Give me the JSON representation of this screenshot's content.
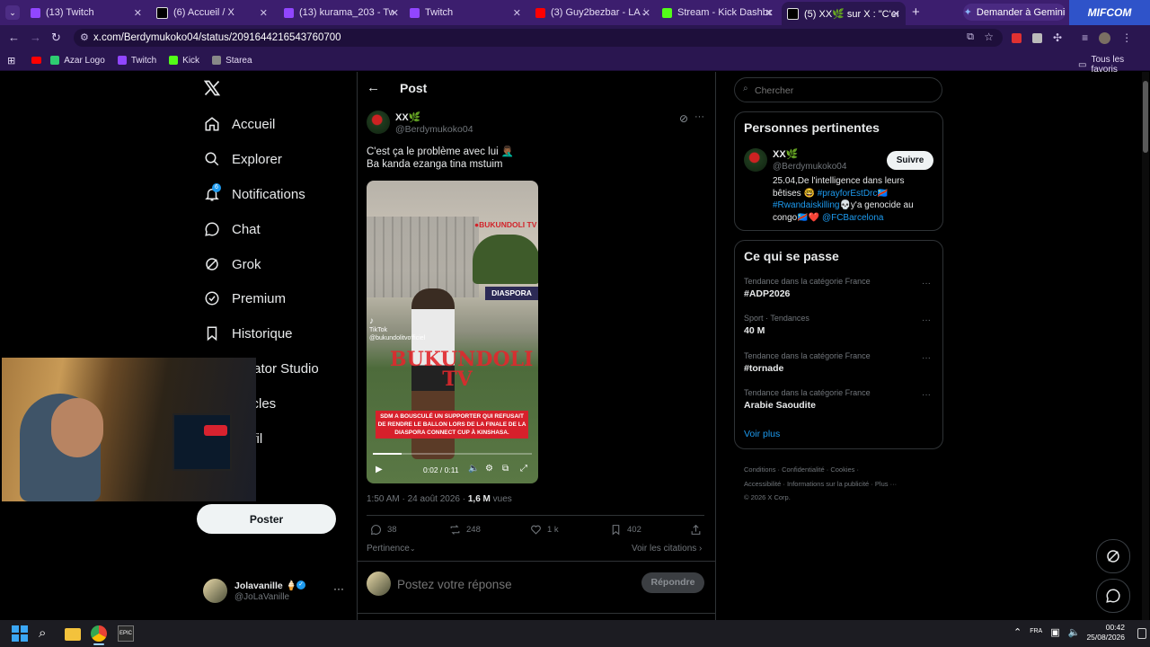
{
  "browser": {
    "tabs": [
      {
        "title": "(13) Twitch",
        "color": "#9146ff"
      },
      {
        "title": "(6) Accueil / X",
        "color": "#000000"
      },
      {
        "title": "(13) kurama_203 - Twitch",
        "color": "#9146ff"
      },
      {
        "title": "Twitch",
        "color": "#9146ff"
      },
      {
        "title": "(3) Guy2bezbar - LA JEUNE",
        "color": "#ff0000"
      },
      {
        "title": "Stream - Kick Dashboard",
        "color": "#53fc18"
      },
      {
        "title": "(5) XX🌿 sur X : \"C'est ça l",
        "color": "#000000"
      }
    ],
    "new_tab": "+",
    "gemini": "Demander à Gemini",
    "promo_badge": "MIFCOM",
    "url": "x.com/Berdymukoko04/status/2091644216543760700",
    "bookmarks": [
      {
        "label": "Azar Logo",
        "color": "#2ecc71"
      },
      {
        "label": "Twitch",
        "color": "#9146ff"
      },
      {
        "label": "Kick",
        "color": "#53fc18"
      },
      {
        "label": "Starea",
        "color": "#888888"
      }
    ],
    "all_bookmarks": "Tous les favoris"
  },
  "nav": {
    "items": [
      {
        "label": "Accueil",
        "icon": "home-icon"
      },
      {
        "label": "Explorer",
        "icon": "search-icon"
      },
      {
        "label": "Notifications",
        "icon": "bell-icon",
        "badge": "6"
      },
      {
        "label": "Chat",
        "icon": "chat-icon"
      },
      {
        "label": "Grok",
        "icon": "grok-icon"
      },
      {
        "label": "Premium",
        "icon": "premium-icon"
      },
      {
        "label": "Historique",
        "icon": "bookmark-icon"
      },
      {
        "label": "Creator Studio",
        "icon": "studio-icon"
      },
      {
        "label": "Articles",
        "icon": "article-icon"
      },
      {
        "label": "Profil",
        "icon": "profile-icon"
      }
    ],
    "post_button": "Poster",
    "account": {
      "name": "Jolavanille 🍦",
      "handle": "@JoLaVanille"
    }
  },
  "post": {
    "header": "Post",
    "author": {
      "name": "XX🌿",
      "handle": "@Berdymukoko04"
    },
    "text_line1": "C'est ça le problème avec lui 🤦🏾‍♂️",
    "text_line2": "Ba kanda ezanga tina mstuim",
    "video": {
      "logo_text": "BUKUNDOLI TV",
      "banner": "DIASPORA",
      "tiktok": "TikTok",
      "tiktok_handle": "@bukundolitvofficiel",
      "watermark": "BUKUNDOLI TV",
      "caption": "SDM A BOUSCULÉ UN SUPPORTER QUI REFUSAIT DE RENDRE LE BALLON LORS DE LA FINALE DE LA DIASPORA CONNECT CUP À KINSHASA.",
      "time": "0:02 / 0:11",
      "progress": 0.18
    },
    "timestamp": "1:50 AM · 24 août 2026 · ",
    "views_count": "1,6 M",
    "views_label": " vues",
    "stats": {
      "replies": "38",
      "reposts": "248",
      "likes": "1 k",
      "bookmarks": "402"
    },
    "sort": "Pertinence",
    "quotes": "Voir les citations",
    "reply_placeholder": "Postez votre réponse",
    "reply_button": "Répondre"
  },
  "sidebar": {
    "search_placeholder": "Chercher",
    "relevant_title": "Personnes pertinentes",
    "relevant_person": {
      "name": "XX🌿",
      "handle": "@Berdymukoko04",
      "follow": "Suivre",
      "bio_1": "25.04,De l'intelligence dans leurs bêtises 🤓 ",
      "bio_tag1": "#prayforEstDrc🇨🇩",
      "bio_tag2": "#Rwandaiskilling",
      "bio_2": "💀y'a genocide au congo🇨🇩❤️ ",
      "bio_tag3": "@FCBarcelona"
    },
    "trends_title": "Ce qui se passe",
    "trends": [
      {
        "meta": "Tendance dans la catégorie France",
        "name": "#ADP2026"
      },
      {
        "meta": "Sport · Tendances",
        "name": "40 M"
      },
      {
        "meta": "Tendance dans la catégorie France",
        "name": "#tornade"
      },
      {
        "meta": "Tendance dans la catégorie France",
        "name": "Arabie Saoudite"
      }
    ],
    "show_more": "Voir plus",
    "footer_1": [
      "Conditions",
      "Confidentialité",
      "Cookies"
    ],
    "footer_2": [
      "Accessibilité",
      "Informations sur la publicité",
      "Plus ···"
    ],
    "copyright": "© 2026 X Corp."
  },
  "taskbar": {
    "time": "00:42",
    "date": "25/08/2026"
  }
}
